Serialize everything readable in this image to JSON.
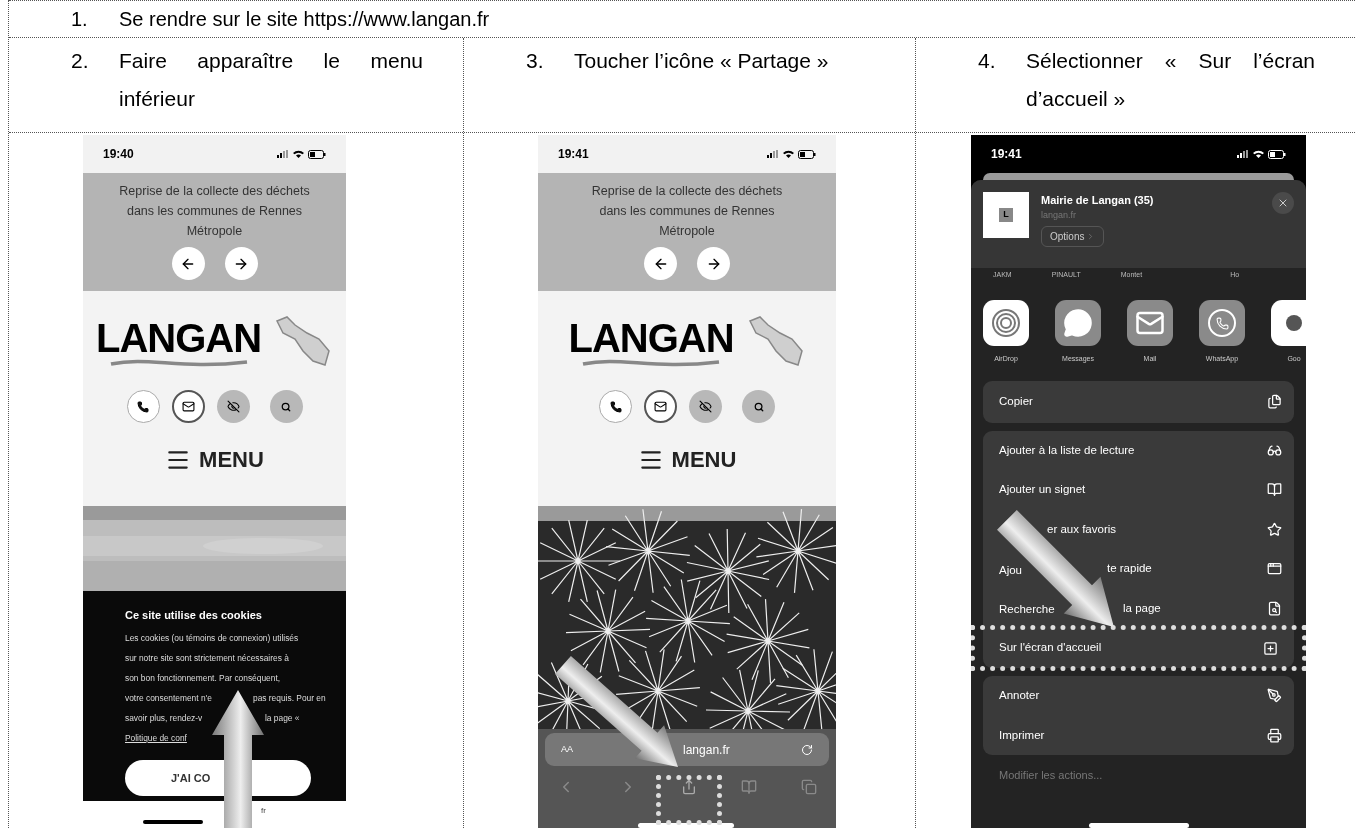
{
  "steps": [
    {
      "number": "1.",
      "text": "Se rendre sur le site https://www.langan.fr"
    }
  ],
  "columns": [
    {
      "number": "2.",
      "text": "Faire apparaître le menu inférieur",
      "phone": {
        "kind": "cookies",
        "time": "19:40",
        "banner": [
          "Reprise de la collecte des déchets",
          "dans les communes de Rennes",
          "Métropole"
        ],
        "logo": "LANGAN",
        "menu": "MENU",
        "cookie": {
          "title": "Ce site utilise des cookies",
          "lines": [
            [
              "Les cookies (ou témoins de connexion) utilisés"
            ],
            [
              "sur notre site sont strictement nécessaires à"
            ],
            [
              "son bon fonctionnement. Par conséquent,"
            ],
            [
              "votre consentement n'e",
              "pas requis. Pour en"
            ],
            [
              "savoir plus, rendez-v",
              "la page «"
            ]
          ],
          "link": "Politique de conf",
          "button": "J'AI CO"
        },
        "footer": "fr"
      }
    },
    {
      "number": "3.",
      "text": "Toucher l’icône « Partage »",
      "phone": {
        "kind": "browser",
        "time": "19:41",
        "banner": [
          "Reprise de la collecte des déchets",
          "dans les communes de Rennes",
          "Métropole"
        ],
        "logo": "LANGAN",
        "menu": "MENU",
        "address_bar": {
          "text_size": "AA",
          "url": "langan.fr"
        }
      }
    },
    {
      "number": "4.",
      "text": "Sélectionner « Sur l’écran d’accueil »",
      "phone": {
        "kind": "share",
        "time": "19:41",
        "header": {
          "thumbnail": "L",
          "title": "Mairie de Langan (35)",
          "subtitle": "langan.fr",
          "options": "Options"
        },
        "contacts": [
          "JAKM",
          "PINAULT",
          "Montet",
          "Ho"
        ],
        "apps": [
          "AirDrop",
          "Messages",
          "Mail",
          "WhatsApp",
          "Goo"
        ],
        "groups": [
          [
            {
              "parts": [
                "Copier"
              ],
              "highlighted": false
            }
          ],
          [
            {
              "parts": [
                "Ajouter à la liste de lecture"
              ],
              "highlighted": false
            },
            {
              "parts": [
                "Ajouter un signet"
              ],
              "highlighted": false
            },
            {
              "parts": [
                "er aux favoris"
              ],
              "highlighted": false
            },
            {
              "parts": [
                "Ajou",
                "te rapide"
              ],
              "highlighted": false
            },
            {
              "parts": [
                "Recherche",
                "la page"
              ],
              "highlighted": false
            },
            {
              "parts": [
                "Sur l'écran d'accueil"
              ],
              "highlighted": true
            }
          ],
          [
            {
              "parts": [
                "Annoter"
              ],
              "highlighted": false
            },
            {
              "parts": [
                "Imprimer"
              ],
              "highlighted": false
            }
          ]
        ],
        "edit": "Modifier les actions..."
      }
    }
  ]
}
